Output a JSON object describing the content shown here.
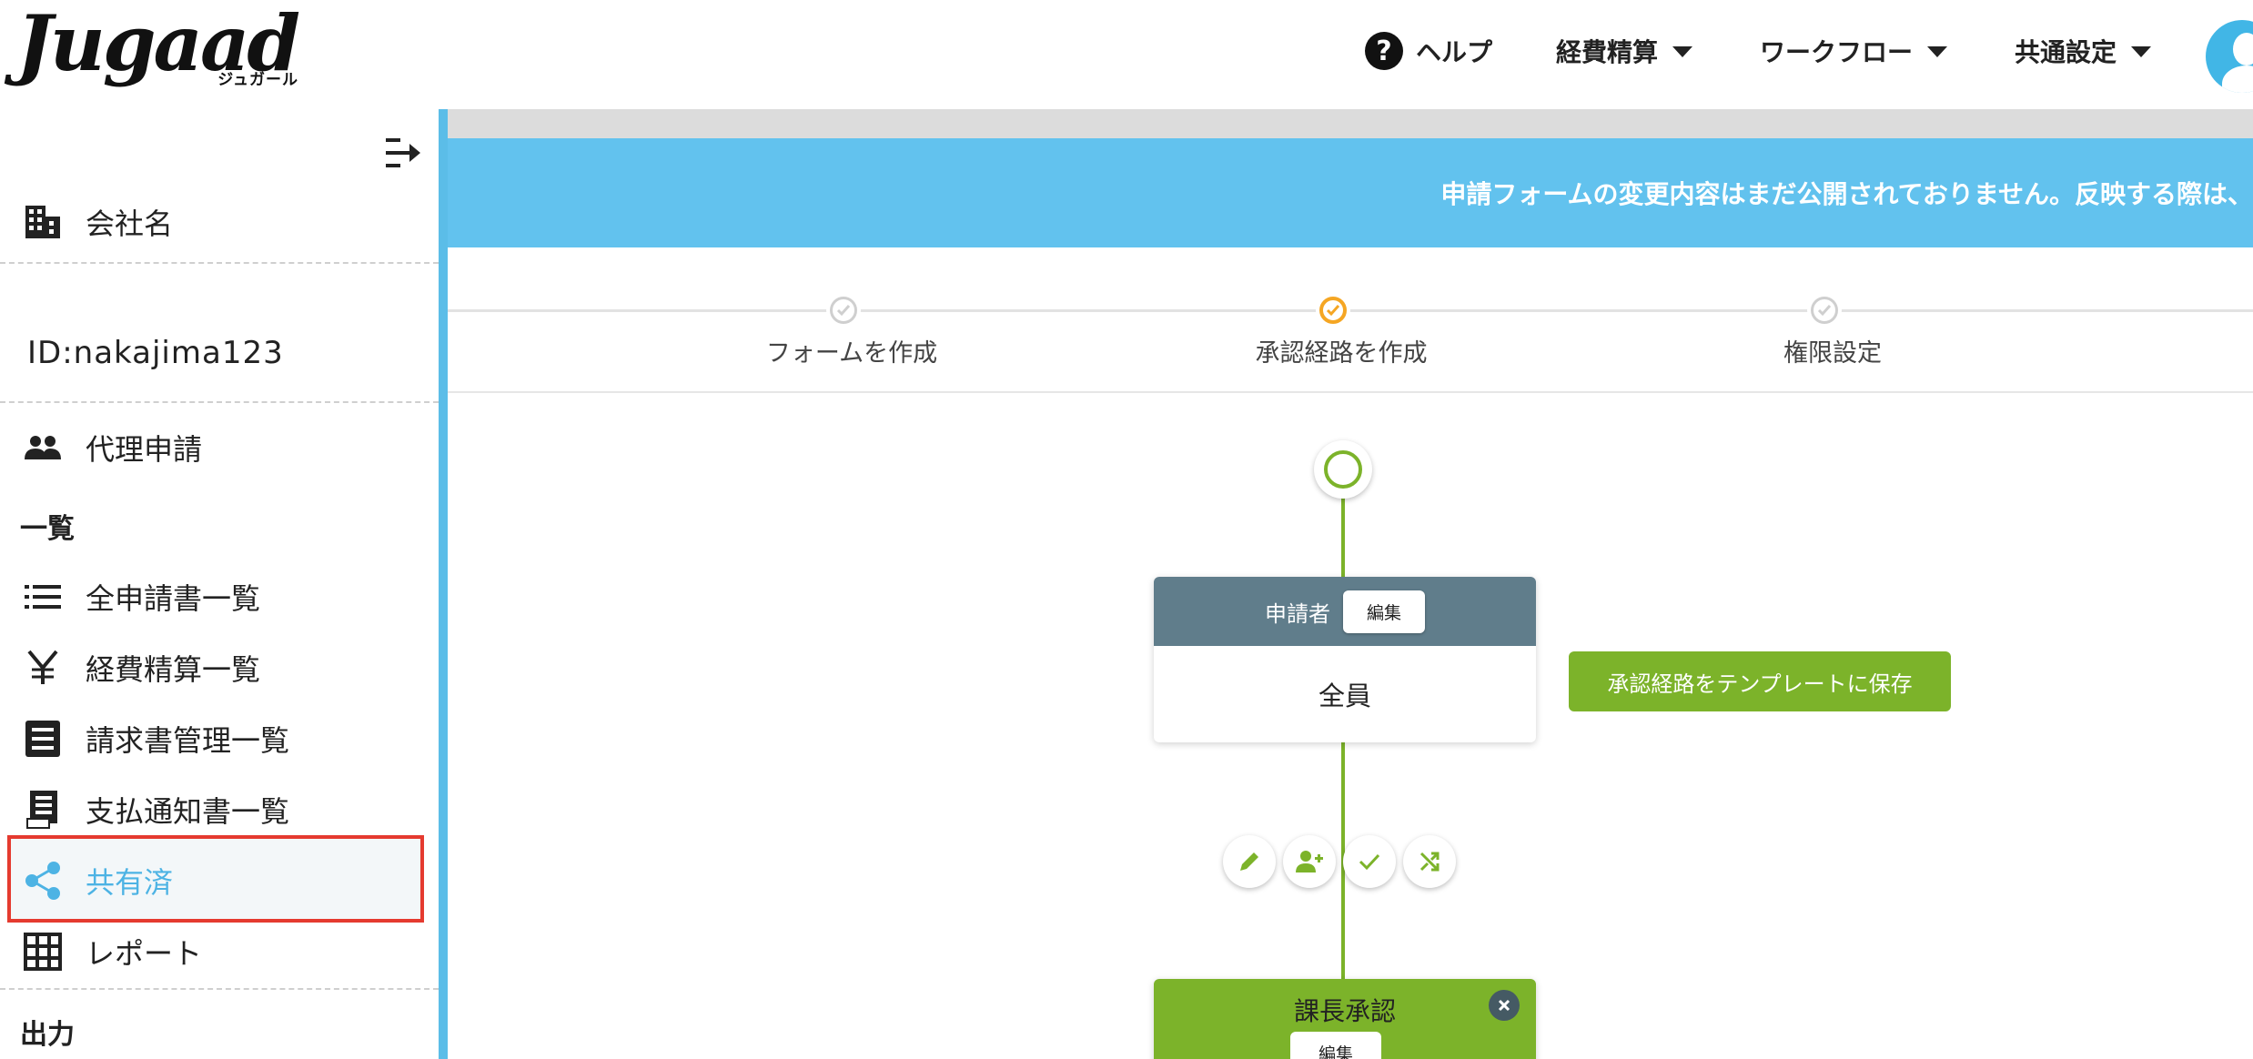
{
  "header": {
    "logo_main": "Jugaad",
    "logo_sub": "ジュガール",
    "help_label": "ヘルプ",
    "help_glyph": "?",
    "nav": [
      {
        "label": "経費精算"
      },
      {
        "label": "ワークフロー"
      },
      {
        "label": "共通設定"
      }
    ]
  },
  "sidebar": {
    "company_label": "会社名",
    "account_id": "ID:nakajima123",
    "proxy_label": "代理申請",
    "section_list": "一覧",
    "items": [
      {
        "label": "全申請書一覧",
        "icon": "list-icon"
      },
      {
        "label": "経費精算一覧",
        "icon": "yen-icon"
      },
      {
        "label": "請求書管理一覧",
        "icon": "invoice-icon"
      },
      {
        "label": "支払通知書一覧",
        "icon": "receipt-icon"
      },
      {
        "label": "共有済",
        "icon": "share-icon",
        "active": true
      },
      {
        "label": "レポート",
        "icon": "grid-icon"
      }
    ],
    "section_output": "出力",
    "accent_color": "#4db3e4"
  },
  "banner": {
    "text": "申請フォームの変更内容はまだ公開されておりません。反映する際は、"
  },
  "steps": [
    {
      "label": "フォームを作成",
      "state": "done"
    },
    {
      "label": "承認経路を作成",
      "state": "current"
    },
    {
      "label": "権限設定",
      "state": "done"
    }
  ],
  "flow": {
    "applicant_card": {
      "title": "申請者",
      "edit_label": "編集",
      "body": "全員"
    },
    "save_template_label": "承認経路をテンプレートに保存",
    "tools": [
      {
        "name": "edit-step-button",
        "icon": "pencil-icon"
      },
      {
        "name": "add-approver-button",
        "icon": "add-person-icon"
      },
      {
        "name": "approve-step-button",
        "icon": "check-icon"
      },
      {
        "name": "branch-step-button",
        "icon": "shuffle-icon"
      }
    ],
    "approval_card": {
      "title": "課長承認",
      "edit_label": "編集"
    },
    "accent_color": "#7cb32a"
  }
}
